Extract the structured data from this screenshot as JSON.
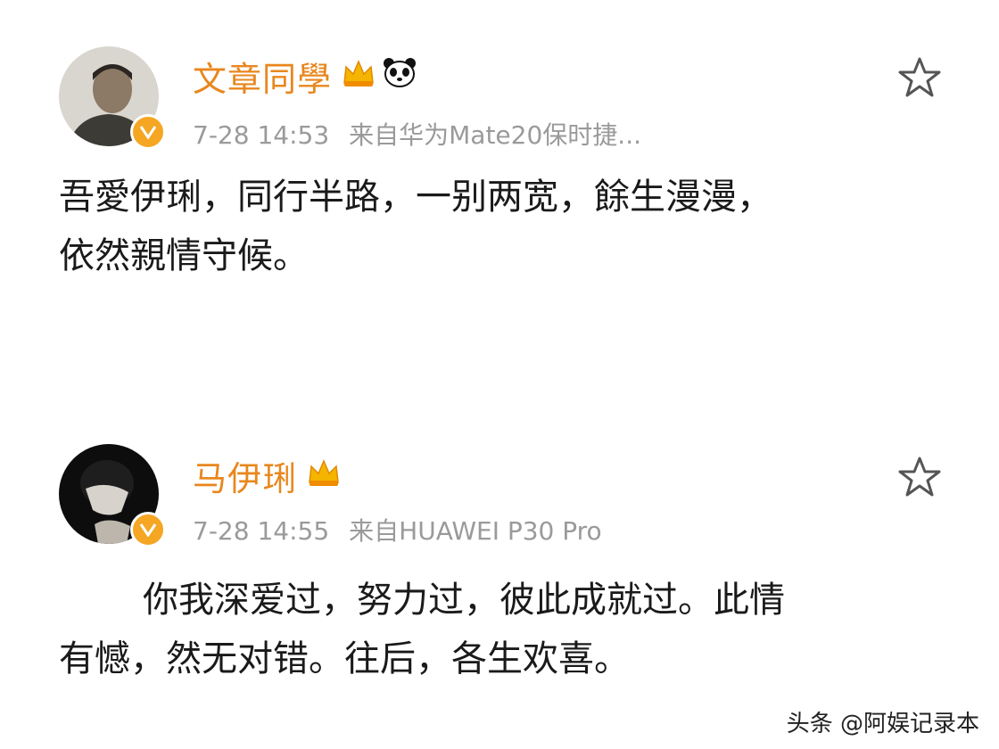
{
  "posts": [
    {
      "username": "文章同學",
      "time": "7-28 14:53",
      "source": "来自华为Mate20保时捷...",
      "content_lines": [
        "吾愛伊琍，同行半路，一别两宽，餘生漫漫，",
        "依然親情守候。"
      ],
      "icons": [
        "avatar-photo",
        "verified-badge-icon",
        "crown-badge-icon",
        "panda-emoji-icon",
        "star-outline-icon"
      ]
    },
    {
      "username": "马伊琍",
      "time": "7-28 14:55",
      "source": "来自HUAWEI P30 Pro",
      "content_lines": [
        "你我深爱过，努力过，彼此成就过。此情",
        "有憾，然无对错。往后，各生欢喜。"
      ],
      "icons": [
        "avatar-photo",
        "verified-badge-icon",
        "crown-badge-icon",
        "star-outline-icon"
      ]
    }
  ],
  "watermark": "头条 @阿娱记录本",
  "colors": {
    "username": "#e8871e",
    "meta": "#9a9a9a",
    "text": "#1a1a1a",
    "badge": "#f5a623"
  }
}
